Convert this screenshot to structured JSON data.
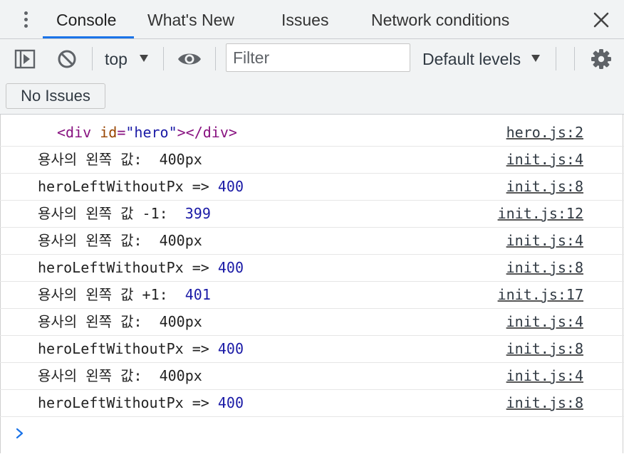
{
  "tabs": [
    {
      "label": "Console",
      "active": true
    },
    {
      "label": "What's New",
      "active": false
    },
    {
      "label": "Issues",
      "active": false
    },
    {
      "label": "Network conditions",
      "active": false
    }
  ],
  "toolbar": {
    "context": "top",
    "filter_placeholder": "Filter",
    "levels": "Default levels"
  },
  "issues": {
    "button_label": "No Issues"
  },
  "messages": [
    {
      "tag_open": "<div ",
      "attr": "id",
      "eq": "=",
      "val": "\"hero\"",
      "tag_close": "></div>",
      "source": "hero.js:2"
    },
    {
      "text": "용사의 왼쪽 값:  400px",
      "source": "init.js:4"
    },
    {
      "text": "heroLeftWithoutPx => ",
      "num": "400",
      "source": "init.js:8"
    },
    {
      "text": "용사의 왼쪽 값 -1:  ",
      "num": "399",
      "source": "init.js:12"
    },
    {
      "text": "용사의 왼쪽 값:  400px",
      "source": "init.js:4"
    },
    {
      "text": "heroLeftWithoutPx => ",
      "num": "400",
      "source": "init.js:8"
    },
    {
      "text": "용사의 왼쪽 값 +1:  ",
      "num": "401",
      "source": "init.js:17"
    },
    {
      "text": "용사의 왼쪽 값:  400px",
      "source": "init.js:4"
    },
    {
      "text": "heroLeftWithoutPx => ",
      "num": "400",
      "source": "init.js:8"
    },
    {
      "text": "용사의 왼쪽 값:  400px",
      "source": "init.js:4"
    },
    {
      "text": "heroLeftWithoutPx => ",
      "num": "400",
      "source": "init.js:8"
    }
  ],
  "colors": {
    "accent": "#1a73e8",
    "number": "#1a1aa6",
    "tag": "#881280",
    "attribute": "#994500"
  }
}
